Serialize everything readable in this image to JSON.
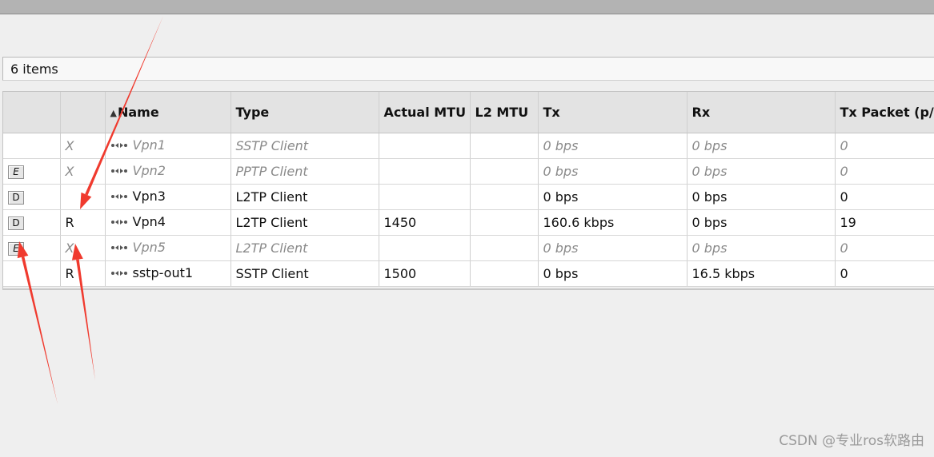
{
  "item_count": "6 items",
  "columns": {
    "col_buttons": "",
    "col_flags": "",
    "name": "Name",
    "type": "Type",
    "actual_mtu": "Actual MTU",
    "l2_mtu": "L2 MTU",
    "tx": "Tx",
    "rx": "Rx",
    "tx_packet": "Tx Packet (p/s)"
  },
  "sort": {
    "column": "Name",
    "direction": "ascending"
  },
  "rows": [
    {
      "button": "",
      "flag": "X",
      "name": "Vpn1",
      "type": "SSTP Client",
      "actual_mtu": "",
      "l2_mtu": "",
      "tx": "0 bps",
      "rx": "0 bps",
      "tx_packet": "0",
      "disabled": true
    },
    {
      "button": "E",
      "flag": "X",
      "name": "Vpn2",
      "type": "PPTP Client",
      "actual_mtu": "",
      "l2_mtu": "",
      "tx": "0 bps",
      "rx": "0 bps",
      "tx_packet": "0",
      "disabled": true
    },
    {
      "button": "D",
      "flag": "",
      "name": "Vpn3",
      "type": "L2TP Client",
      "actual_mtu": "",
      "l2_mtu": "",
      "tx": "0 bps",
      "rx": "0 bps",
      "tx_packet": "0",
      "disabled": false
    },
    {
      "button": "D",
      "flag": "R",
      "name": "Vpn4",
      "type": "L2TP Client",
      "actual_mtu": "1450",
      "l2_mtu": "",
      "tx": "160.6 kbps",
      "rx": "0 bps",
      "tx_packet": "19",
      "disabled": false
    },
    {
      "button": "E",
      "flag": "X",
      "name": "Vpn5",
      "type": "L2TP Client",
      "actual_mtu": "",
      "l2_mtu": "",
      "tx": "0 bps",
      "rx": "0 bps",
      "tx_packet": "0",
      "disabled": true
    },
    {
      "button": "",
      "flag": "R",
      "name": "sstp-out1",
      "type": "SSTP Client",
      "actual_mtu": "1500",
      "l2_mtu": "",
      "tx": "0 bps",
      "rx": "16.5 kbps",
      "tx_packet": "0",
      "disabled": false
    }
  ],
  "icons": {
    "interface": "interface-tunnel-icon",
    "sort": "sort-ascending-icon"
  },
  "annotation_color": "#f03a2e",
  "watermark": "CSDN @专业ros软路由"
}
